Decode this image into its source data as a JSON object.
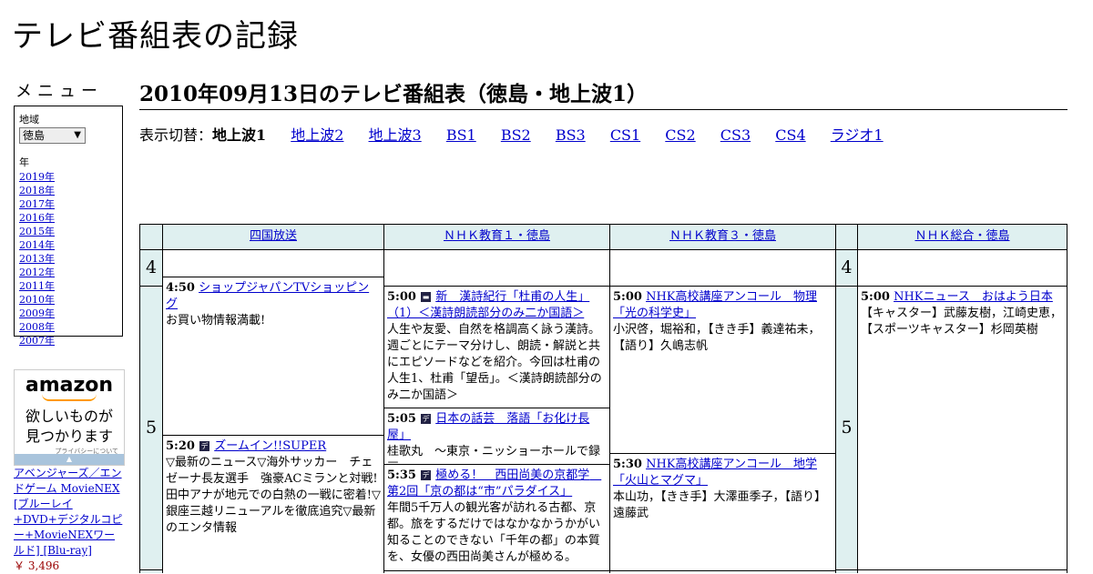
{
  "site_title": "テレビ番組表の記録",
  "sidebar": {
    "menu_label": "メニュー",
    "region_label": "地域",
    "region_value": "徳島",
    "year_label": "年",
    "years": [
      "2019年",
      "2018年",
      "2017年",
      "2016年",
      "2015年",
      "2014年",
      "2013年",
      "2012年",
      "2011年",
      "2010年",
      "2009年",
      "2008年",
      "2007年"
    ]
  },
  "ad": {
    "logo": "amazon",
    "message_line1": "欲しいものが",
    "message_line2": "見つかります",
    "privacy": "プライバシーについて",
    "product_title": "アベンジャーズ／エンドゲーム MovieNEX [ブルーレイ+DVD+デジタルコピー+MovieNEXワールド] [Blu-ray]",
    "product_price": "￥ 3,496"
  },
  "page_heading": "2010年09月13日のテレビ番組表（徳島・地上波1）",
  "switcher": {
    "label": "表示切替：",
    "current": "地上波1",
    "links": [
      "地上波2",
      "地上波3",
      "BS1",
      "BS2",
      "BS3",
      "CS1",
      "CS2",
      "CS3",
      "CS4",
      "ラジオ1"
    ]
  },
  "channels": [
    "四国放送",
    "ＮＨＫ教育１・徳島",
    "ＮＨＫ教育３・徳島",
    "ＮＨＫ総合・徳島"
  ],
  "hours": [
    "4",
    "5",
    "4",
    "5"
  ],
  "programs": {
    "shikoku_1": {
      "time": "4:50",
      "title": "ショップジャパンTVショッピング",
      "desc": "お買い物情報満載!"
    },
    "shikoku_2": {
      "time": "5:20",
      "title": "ズームイン!!SUPER",
      "desc": "▽最新のニュース▽海外サッカー　チェゼーナ長友選手　強豪ACミランと対戦!田中アナが地元での白熱の一戦に密着!▽銀座三越リニューアルを徹底追究▽最新のエンタ情報"
    },
    "edu1_1": {
      "time": "5:00",
      "title": "新　漢詩紀行「杜甫の人生」（1）＜漢詩朗読部分のみ二か国語＞",
      "desc": "人生や友愛、自然を格調高く詠う漢詩。週ごとにテーマ分けし、朗読・解説と共にエピソードなどを紹介。今回は杜甫の人生1、杜甫「望岳」。＜漢詩朗読部分のみ二か国語＞"
    },
    "edu1_2": {
      "time": "5:05",
      "title": "日本の話芸　落語「お化け長屋」",
      "desc": "桂歌丸　～東京・ニッショーホールで録画～"
    },
    "edu1_3": {
      "time": "5:35",
      "title": "極める！　西田尚美の京都学　第2回「京の都は“市”パラダイス」",
      "desc": "年間5千万人の観光客が訪れる古都、京都。旅をするだけではなかなかうかがい知ることのできない「千年の都」の本質を、女優の西田尚美さんが極める。"
    },
    "edu3_1": {
      "time": "5:00",
      "title": "NHK高校講座アンコール　物理「光の科学史」",
      "desc": "小沢啓，堀裕和，【きき手】義達祐未，【語り】久嶋志帆"
    },
    "edu3_2": {
      "time": "5:30",
      "title": "NHK高校講座アンコール　地学「火山とマグマ」",
      "desc": "本山功，【きき手】大澤亜季子，【語り】遠藤武"
    },
    "nhk_1": {
      "time": "5:00",
      "title": "NHKニュース　おはよう日本",
      "desc": "【キャスター】武藤友樹，江崎史恵，【スポーツキャスター】杉岡英樹"
    }
  }
}
